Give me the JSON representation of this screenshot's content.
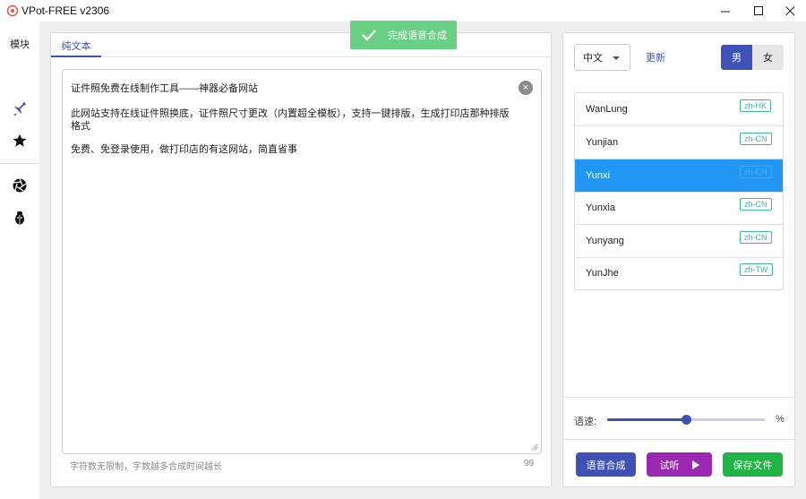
{
  "window": {
    "title": "VPot-FREE v2306",
    "minimize_icon": "minimize-icon",
    "maximize_icon": "maximize-icon",
    "close_icon": "close-icon"
  },
  "toast": {
    "message": "完成语音合成",
    "icon": "check-icon"
  },
  "sidebar": {
    "title": "模块",
    "icons": [
      "satellite-dish-icon",
      "star-icon",
      "aperture-icon",
      "bug-icon"
    ]
  },
  "editor": {
    "tab_label": "纯文本",
    "lines": [
      "证件照免费在线制作工具——神器必备网站",
      "此网站支持在线证件照换底，证件照尺寸更改（内置超全模板），支持一键排版，生成打印店那种排版",
      "格式",
      "免费、免登录使用，做打印店的有这网站，简直省事"
    ],
    "clear_icon": "clear-circle-icon",
    "hint": "字符数无限制，字数越多合成时间越长",
    "char_count": "99"
  },
  "voice_panel": {
    "language": "中文",
    "update_label": "更新",
    "gender": {
      "male": "男",
      "female": "女",
      "selected": "男"
    },
    "voices": [
      {
        "name": "WanLung",
        "locale": "zh-HK",
        "selected": false
      },
      {
        "name": "Yunjian",
        "locale": "zh-CN",
        "selected": false
      },
      {
        "name": "Yunxi",
        "locale": "zh-CN",
        "selected": true
      },
      {
        "name": "Yunxia",
        "locale": "zh-CN",
        "selected": false
      },
      {
        "name": "Yunyang",
        "locale": "zh-CN",
        "selected": false
      },
      {
        "name": "YunJhe",
        "locale": "zh-TW",
        "selected": false
      }
    ],
    "speed": {
      "label": "语速:",
      "unit": "%",
      "fraction": 0.5
    },
    "buttons": {
      "synthesize": "语音合成",
      "listen": "试听",
      "save": "保存文件"
    }
  },
  "colors": {
    "primary": "#3f51b5",
    "selected_row": "#2196f3",
    "toast": "#69cf84",
    "listen": "#9c27b0",
    "save": "#1fb444",
    "tag": "#40b69a"
  }
}
